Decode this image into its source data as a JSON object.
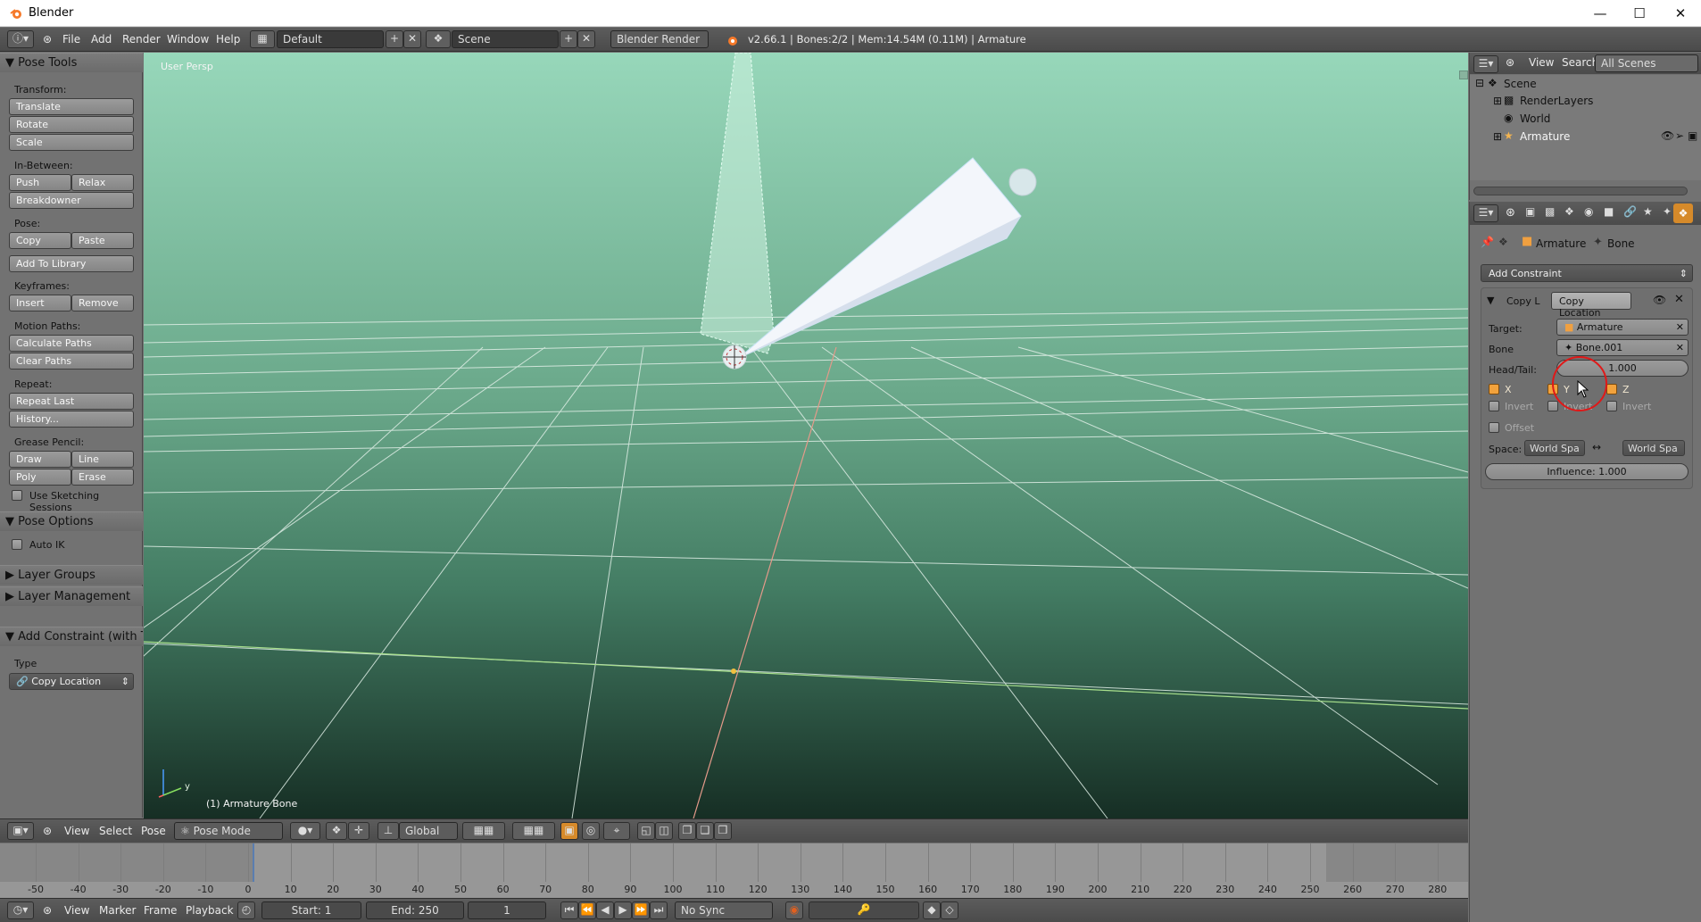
{
  "window": {
    "title": "Blender"
  },
  "topbar": {
    "menus": [
      "File",
      "Add",
      "Render",
      "Window",
      "Help"
    ],
    "screen_layout": "Default",
    "scene": "Scene",
    "render_engine": "Blender Render",
    "stats": "v2.66.1 | Bones:2/2 | Mem:14.54M (0.11M) | Armature"
  },
  "toolshelf": {
    "pose_tools_title": "Pose Tools",
    "transform_label": "Transform:",
    "translate": "Translate",
    "rotate": "Rotate",
    "scale": "Scale",
    "in_between_label": "In-Between:",
    "push": "Push",
    "relax": "Relax",
    "breakdowner": "Breakdowner",
    "pose_label": "Pose:",
    "copy": "Copy",
    "paste": "Paste",
    "add_to_library": "Add To Library",
    "keyframes_label": "Keyframes:",
    "insert": "Insert",
    "remove": "Remove",
    "motion_paths_label": "Motion Paths:",
    "calculate_paths": "Calculate Paths",
    "clear_paths": "Clear Paths",
    "repeat_label": "Repeat:",
    "repeat_last": "Repeat Last",
    "history": "History...",
    "grease_pencil_label": "Grease Pencil:",
    "draw": "Draw",
    "line": "Line",
    "poly": "Poly",
    "erase": "Erase",
    "use_sketching_sessions": "Use Sketching Sessions",
    "pose_options_title": "Pose Options",
    "auto_ik": "Auto IK",
    "layer_groups_title": "Layer Groups",
    "layer_management_title": "Layer Management",
    "add_constraint_title": "Add Constraint (with Tar",
    "type_label": "Type",
    "type_value": "Copy Location"
  },
  "viewport": {
    "view_label": "User Persp",
    "object_info": "(1) Armature Bone",
    "axis_y": "y"
  },
  "view3d_header": {
    "menus": [
      "View",
      "Select",
      "Pose"
    ],
    "mode": "Pose Mode",
    "orientation": "Global"
  },
  "timeline": {
    "ticks": [
      "-50",
      "-40",
      "-30",
      "-20",
      "-10",
      "0",
      "10",
      "20",
      "30",
      "40",
      "50",
      "60",
      "70",
      "80",
      "90",
      "100",
      "110",
      "120",
      "130",
      "140",
      "150",
      "160",
      "170",
      "180",
      "190",
      "200",
      "210",
      "220",
      "230",
      "240",
      "250",
      "260",
      "270",
      "280"
    ],
    "menus": [
      "View",
      "Marker",
      "Frame",
      "Playback"
    ],
    "start": "Start: 1",
    "end": "End: 250",
    "current_frame": "1",
    "sync": "No Sync"
  },
  "outliner": {
    "view": "View",
    "search": "Search",
    "scenes_filter": "All Scenes",
    "items": [
      "Scene",
      "RenderLayers",
      "World",
      "Armature"
    ]
  },
  "properties": {
    "breadcrumb_object": "Armature",
    "breadcrumb_bone": "Bone",
    "add_constraint": "Add Constraint",
    "constraint_name": "Copy L",
    "constraint_type": "Copy Location",
    "target_label": "Target:",
    "target_value": "Armature",
    "bone_label": "Bone",
    "bone_value": "Bone.001",
    "head_tail_label": "Head/Tail:",
    "head_tail_value": "1.000",
    "x_label": "X",
    "y_label": "Y",
    "z_label": "Z",
    "invert": "Invert",
    "offset": "Offset",
    "space_label": "Space:",
    "owner_space": "World Spa",
    "target_space": "World Spa",
    "influence": "Influence: 1.000"
  }
}
